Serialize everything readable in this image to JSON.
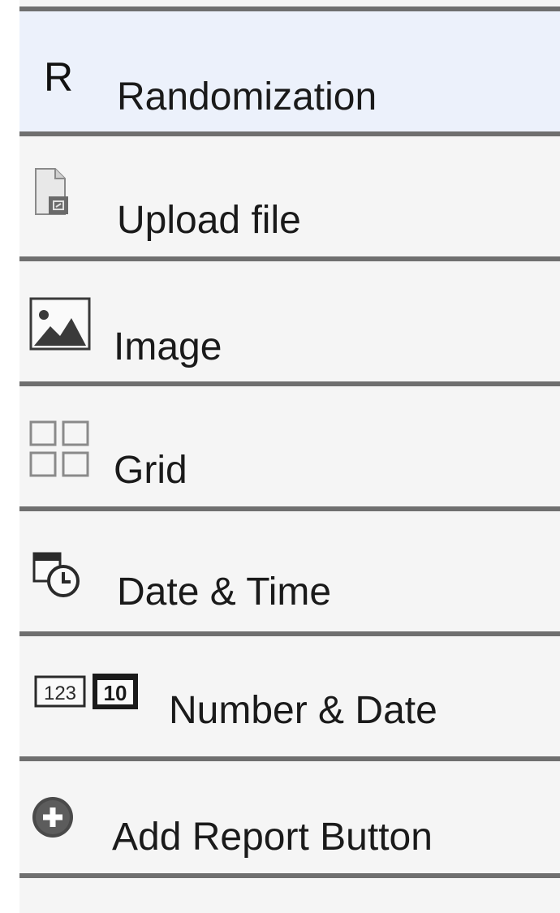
{
  "menu": {
    "items": [
      {
        "id": "randomization",
        "label": "Randomization",
        "icon": "randomization-r-icon",
        "glyph": "R",
        "selected": true
      },
      {
        "id": "upload-file",
        "label": "Upload file",
        "icon": "upload-file-icon",
        "selected": false
      },
      {
        "id": "image",
        "label": "Image",
        "icon": "image-icon",
        "selected": false
      },
      {
        "id": "grid",
        "label": "Grid",
        "icon": "grid-icon",
        "selected": false
      },
      {
        "id": "date-time",
        "label": "Date & Time",
        "icon": "date-time-icon",
        "selected": false
      },
      {
        "id": "number-date",
        "label": "Number & Date",
        "icon": "number-date-icon",
        "icon_text_left": "123",
        "icon_text_right": "10",
        "selected": false
      },
      {
        "id": "add-report-button",
        "label": "Add Report Button",
        "icon": "plus-circle-icon",
        "selected": false
      }
    ]
  },
  "colors": {
    "panel_bg": "#f5f5f5",
    "selected_bg": "#ecf1fb",
    "divider": "#6f6f6f",
    "text": "#1a1a1a"
  }
}
